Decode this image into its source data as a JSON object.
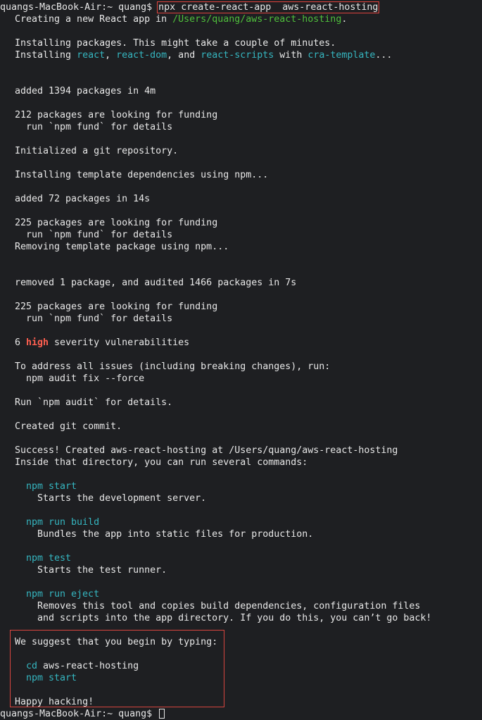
{
  "prompt": "quangs-MacBook-Air:~ quang$",
  "command": "npx create-react-app  aws-react-hosting",
  "lines": {
    "creating_prefix": "Creating a new React app in ",
    "creating_path": "/Users/quang/aws-react-hosting",
    "creating_suffix": ".",
    "installing_packages": "Installing packages. This might take a couple of minutes.",
    "installing_prefix": "Installing ",
    "pkg_react": "react",
    "sep1": ", ",
    "pkg_react_dom": "react-dom",
    "sep2": ", and ",
    "pkg_react_scripts": "react-scripts",
    "sep3": " with ",
    "pkg_cra_template": "cra-template",
    "sep4": "...",
    "added_1394": "added 1394 packages in 4m",
    "funding_212": "212 packages are looking for funding",
    "npm_fund_1": "run `npm fund` for details",
    "git_init": "Initialized a git repository.",
    "installing_template": "Installing template dependencies using npm...",
    "added_72": "added 72 packages in 14s",
    "funding_225_a": "225 packages are looking for funding",
    "npm_fund_2": "run `npm fund` for details",
    "removing_template": "Removing template package using npm...",
    "removed_1": "removed 1 package, and audited 1466 packages in 7s",
    "funding_225_b": "225 packages are looking for funding",
    "npm_fund_3": "run `npm fund` for details",
    "vuln_count": "6 ",
    "vuln_level": "high",
    "vuln_suffix": " severity vulnerabilities",
    "to_address": "To address all issues (including breaking changes), run:",
    "audit_fix": "npm audit fix --force",
    "run_audit": "Run `npm audit` for details.",
    "git_commit": "Created git commit.",
    "success": "Success! Created aws-react-hosting at /Users/quang/aws-react-hosting",
    "inside_dir": "Inside that directory, you can run several commands:",
    "cmd_start": "npm start",
    "desc_start": "Starts the development server.",
    "cmd_build": "npm run build",
    "desc_build": "Bundles the app into static files for production.",
    "cmd_test": "npm test",
    "desc_test": "Starts the test runner.",
    "cmd_eject": "npm run eject",
    "desc_eject_1": "Removes this tool and copies build dependencies, configuration files",
    "desc_eject_2": "and scripts into the app directory. If you do this, you can’t go back!",
    "suggest": "We suggest that you begin by typing:",
    "cd_cmd": "cd",
    "cd_arg": " aws-react-hosting",
    "suggest_start": "npm start",
    "happy": "Happy hacking!"
  },
  "colors": {
    "background": "#1e1f22",
    "text": "#e8e8e8",
    "path_green": "#4fbf3b",
    "pkg_cyan": "#35b6c0",
    "high_red": "#ff5f50",
    "highlight_box": "#e0433d"
  }
}
